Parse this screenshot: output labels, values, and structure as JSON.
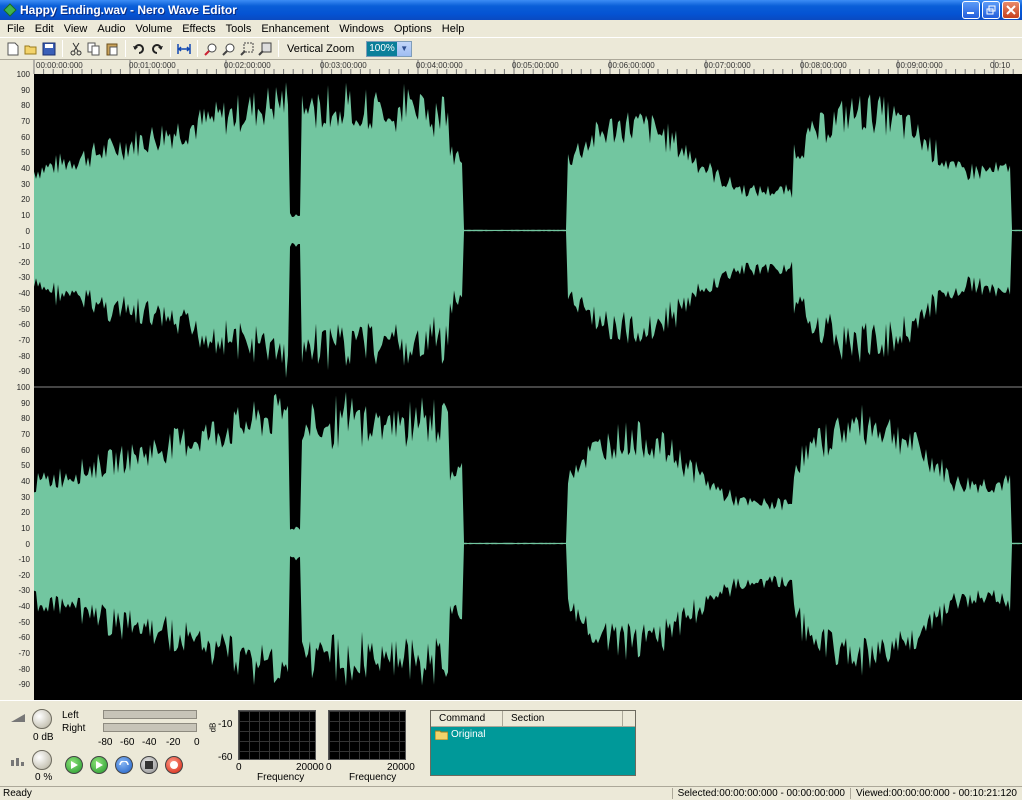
{
  "window": {
    "title": "Happy Ending.wav - Nero Wave Editor"
  },
  "menu": [
    "File",
    "Edit",
    "View",
    "Audio",
    "Volume",
    "Effects",
    "Tools",
    "Enhancement",
    "Windows",
    "Options",
    "Help"
  ],
  "toolbar": {
    "vertical_zoom_label": "Vertical Zoom",
    "zoom_value": "100%"
  },
  "ruler": [
    "00:00:00:000",
    "00:01:00:000",
    "00:02:00:000",
    "00:03:00:000",
    "00:04:00:000",
    "00:05:00:000",
    "00:06:00:000",
    "00:07:00:000",
    "00:08:00:000",
    "00:09:00:000",
    "00:10"
  ],
  "y_labels": [
    "100",
    "90",
    "80",
    "70",
    "60",
    "50",
    "40",
    "30",
    "20",
    "10",
    "0",
    "-10",
    "-20",
    "-30",
    "-40",
    "-50",
    "-60",
    "-70",
    "-80",
    "-90"
  ],
  "colors": {
    "wave": "#72c6a0",
    "wave_bg": "#000000",
    "history_bg": "#009999"
  },
  "bottom": {
    "volume_db": "0 dB",
    "pan": "0 %",
    "left_label": "Left",
    "right_label": "Right",
    "meter_scale": [
      "-80",
      "-60",
      "-40",
      "-20",
      "0"
    ],
    "db_unit": "dB",
    "freq_y": [
      "-10",
      "-60"
    ],
    "freq_x": [
      "0",
      "20000"
    ],
    "freq_label": "Frequency",
    "history_cols": [
      "Command",
      "Section"
    ],
    "history_row": "Original"
  },
  "status": {
    "left": "Ready",
    "selected": "Selected:00:00:00:000 - 00:00:00:000",
    "viewed": "Viewed:00:00:00:000 - 00:10:21:120"
  }
}
